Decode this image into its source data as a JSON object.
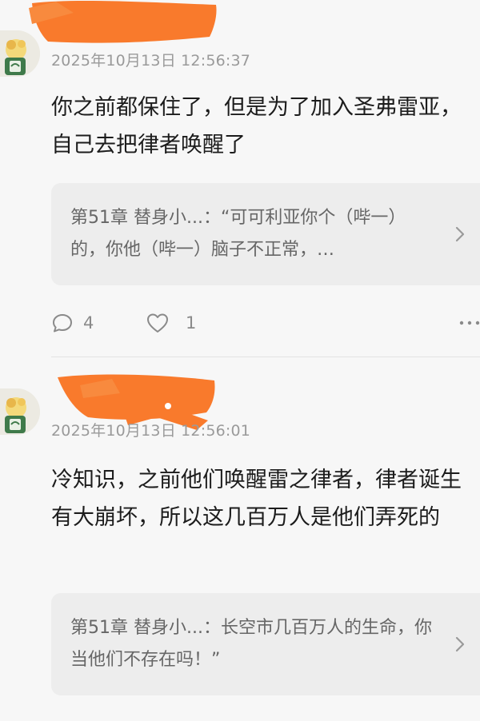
{
  "comments": [
    {
      "timestamp": "2025年10月13日 12:56:37",
      "text": "你之前都保住了，但是为了加入圣弗雷亚，自己去把律者唤醒了",
      "quote": {
        "text": "第51章 替身小...：“可可利亚你个（哔一）的，你他（哔一）脑子不正常，…"
      },
      "actions": {
        "reply_count": "4",
        "like_count": "1"
      }
    },
    {
      "timestamp": "2025年10月13日 12:56:01",
      "text": "冷知识，之前他们唤醒雷之律者，律者诞生有大崩坏，所以这几百万人是他们弄死的",
      "quote": {
        "text": "第51章 替身小...：长空市几百万人的生命，你当他们不存在吗！”"
      }
    }
  ],
  "icons": [
    "avatar-icon",
    "comment-icon",
    "heart-icon",
    "more-icon",
    "chevron-right-icon"
  ],
  "colors": {
    "background": "#f7f7f7",
    "quote_background": "#ededed",
    "timestamp": "#9a9a9a",
    "redaction": "#f97a2c"
  }
}
